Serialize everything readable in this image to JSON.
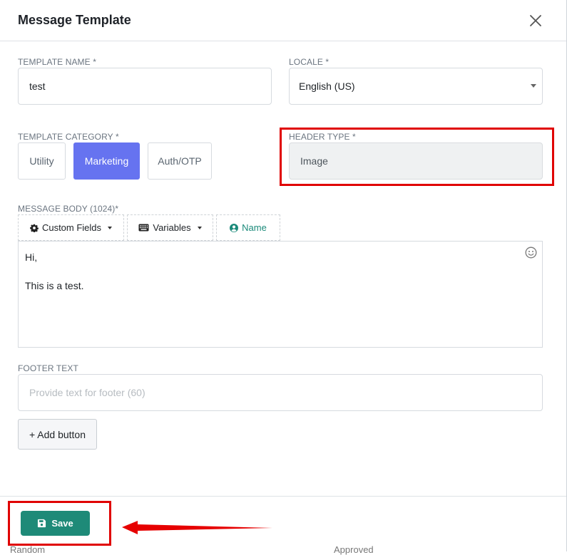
{
  "modal": {
    "title": "Message Template"
  },
  "form": {
    "template_name": {
      "label": "TEMPLATE NAME *",
      "value": "test"
    },
    "locale": {
      "label": "LOCALE *",
      "value": "English (US)"
    },
    "template_category": {
      "label": "TEMPLATE CATEGORY *",
      "options": [
        "Utility",
        "Marketing",
        "Auth/OTP"
      ],
      "selected": "Marketing"
    },
    "header_type": {
      "label": "HEADER TYPE *",
      "value": "Image"
    },
    "message_body": {
      "label": "MESSAGE BODY (1024)*",
      "toolbar": {
        "custom_fields": "Custom Fields",
        "variables": "Variables",
        "name": "Name"
      },
      "lines": [
        "Hi,",
        "",
        "This is a test."
      ]
    },
    "footer_text": {
      "label": "FOOTER TEXT",
      "placeholder": "Provide text for footer (60)"
    },
    "add_button_label": "+ Add button"
  },
  "footer": {
    "save_label": "Save"
  },
  "background_partial_text": [
    "Random",
    "Approved"
  ],
  "colors": {
    "accent": "#6673f0",
    "save": "#1e8a78",
    "annotation": "#e00000"
  },
  "icons": {
    "close": "close-icon",
    "gear": "gear-icon",
    "keyboard": "keyboard-icon",
    "user": "user-circle-icon",
    "emoji": "smiley-icon",
    "save": "floppy-disk-icon"
  }
}
